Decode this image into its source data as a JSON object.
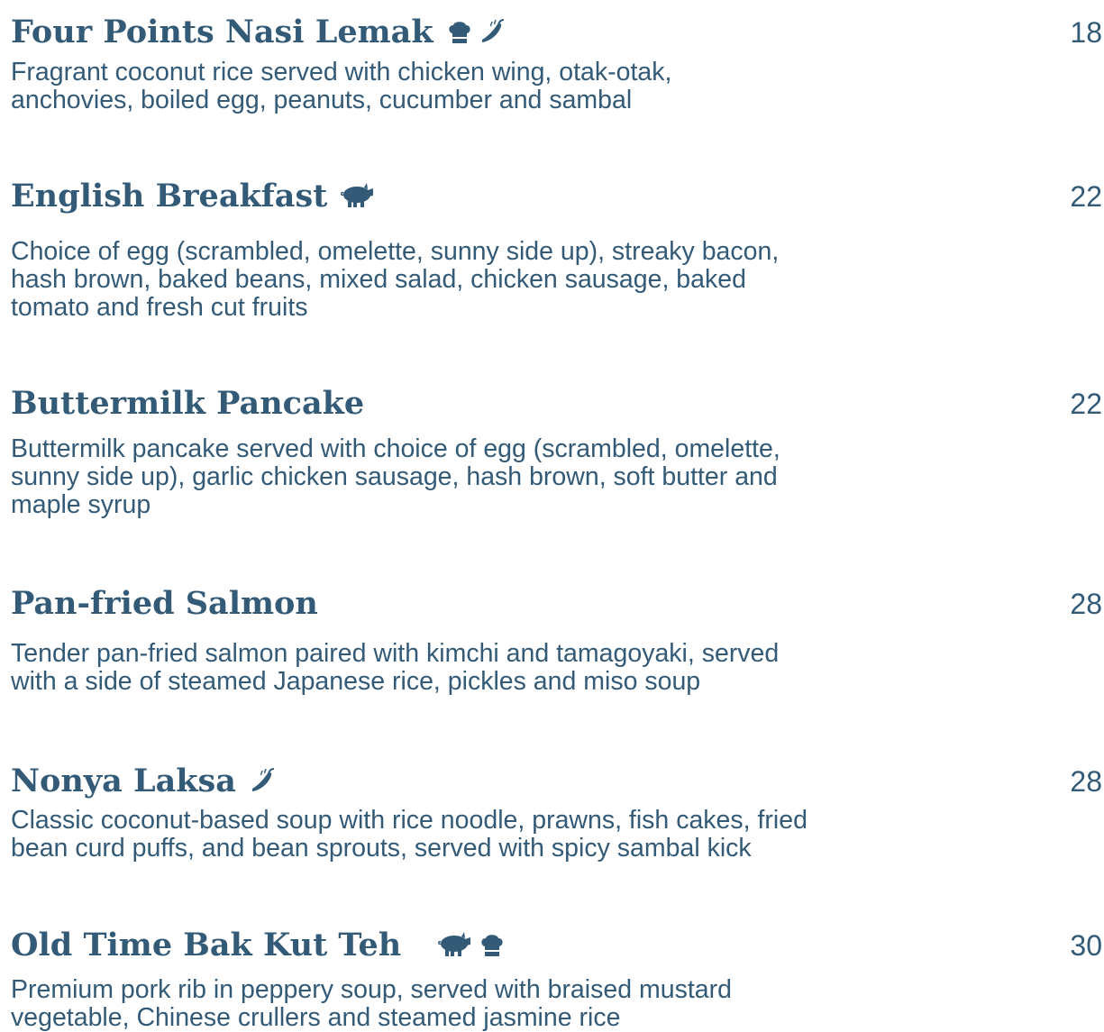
{
  "colors": {
    "text": "#335a77",
    "background": "#ffffff"
  },
  "items": [
    {
      "name": "Four Points Nasi Lemak",
      "price": "18",
      "icons": [
        "chef-hat-icon",
        "chili-icon"
      ],
      "description": [
        "Fragrant coconut rice served with chicken wing, otak-otak,",
        "anchovies, boiled egg, peanuts, cucumber and sambal"
      ]
    },
    {
      "name": "English Breakfast",
      "price": "22",
      "icons": [
        "pig-icon"
      ],
      "description": [
        "Choice of egg (scrambled, omelette, sunny side up), streaky bacon,",
        "hash brown, baked beans, mixed salad, chicken sausage, baked",
        "tomato and fresh cut fruits"
      ]
    },
    {
      "name": "Buttermilk Pancake",
      "price": "22",
      "icons": [],
      "description": [
        "Buttermilk pancake served with choice of egg (scrambled, omelette,",
        "sunny side up), garlic chicken sausage, hash brown, soft butter and",
        "maple syrup"
      ]
    },
    {
      "name": "Pan-fried Salmon",
      "price": "28",
      "icons": [],
      "description": [
        "Tender pan-fried salmon paired with kimchi and tamagoyaki, served",
        "with a side of steamed Japanese rice, pickles and miso soup"
      ]
    },
    {
      "name": "Nonya Laksa",
      "price": "28",
      "icons": [
        "chili-icon"
      ],
      "description": [
        "Classic coconut-based soup with rice noodle, prawns, fish cakes, fried",
        "bean curd puffs, and bean sprouts, served with spicy sambal kick"
      ]
    },
    {
      "name": "Old Time Bak Kut Teh",
      "price": "30",
      "icons": [
        "pig-icon",
        "chef-hat-icon"
      ],
      "description": [
        "Premium pork rib in peppery soup, served with braised mustard",
        "vegetable, Chinese crullers and steamed jasmine rice"
      ]
    }
  ]
}
